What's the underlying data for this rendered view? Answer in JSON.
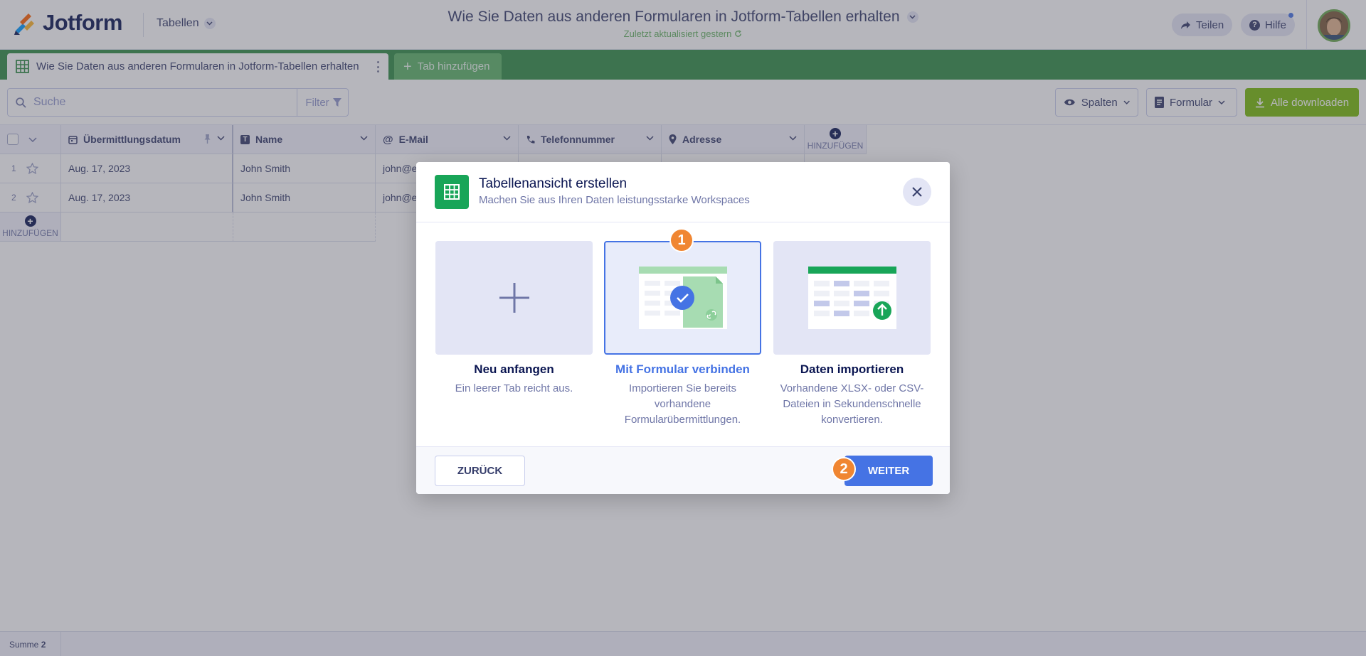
{
  "header": {
    "logo_text": "Jotform",
    "tables_menu": "Tabellen",
    "doc_title": "Wie Sie Daten aus anderen Formularen in Jotform-Tabellen erhalten",
    "doc_subtitle": "Zuletzt aktualisiert gestern",
    "share_label": "Teilen",
    "help_label": "Hilfe"
  },
  "tabs": {
    "active_label": "Wie Sie Daten aus anderen Formularen in Jotform-Tabellen erhalten",
    "add_label": "Tab hinzufügen"
  },
  "toolbar": {
    "search_placeholder": "Suche",
    "filter_label": "Filter",
    "columns_label": "Spalten",
    "form_label": "Formular",
    "download_label": "Alle downloaden"
  },
  "grid": {
    "columns": [
      {
        "label": "Übermittlungsdatum",
        "icon": "calendar-icon"
      },
      {
        "label": "Name",
        "icon": "text-icon"
      },
      {
        "label": "E-Mail",
        "icon": "at-icon"
      },
      {
        "label": "Telefonnummer",
        "icon": "phone-icon"
      },
      {
        "label": "Adresse",
        "icon": "location-icon"
      }
    ],
    "add_label": "HINZUFÜGEN",
    "rows": [
      {
        "num": "1",
        "date": "Aug. 17, 2023",
        "name": "John Smith",
        "email": "john@e"
      },
      {
        "num": "2",
        "date": "Aug. 17, 2023",
        "name": "John Smith",
        "email": "john@e"
      }
    ],
    "add_row_label": "HINZUFÜGEN",
    "sum_label": "Summe",
    "sum_value": "2"
  },
  "modal": {
    "title": "Tabellenansicht erstellen",
    "subtitle": "Machen Sie aus Ihren Daten leistungsstarke Workspaces",
    "options": [
      {
        "title": "Neu anfangen",
        "description": "Ein leerer Tab reicht aus."
      },
      {
        "title": "Mit Formular verbinden",
        "description": "Importieren Sie bereits vorhandene Formularübermittlungen."
      },
      {
        "title": "Daten importieren",
        "description": "Vorhandene XLSX- oder CSV-Dateien in Sekundenschnelle konvertieren."
      }
    ],
    "back_label": "ZURÜCK",
    "next_label": "WEITER",
    "step1": "1",
    "step2": "2"
  },
  "colors": {
    "brand_green": "#2f8c44",
    "accent_blue": "#4573e4",
    "step_orange": "#f08632",
    "download_green": "#78bb07"
  }
}
